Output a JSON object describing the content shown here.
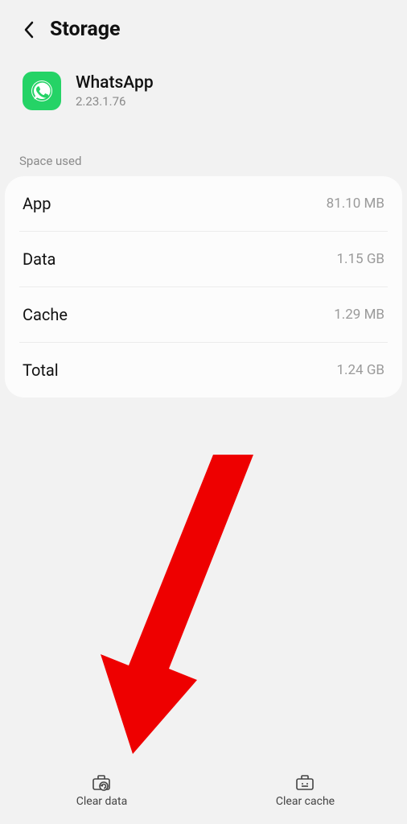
{
  "header": {
    "title": "Storage"
  },
  "app": {
    "name": "WhatsApp",
    "version": "2.23.1.76"
  },
  "section_label": "Space used",
  "rows": [
    {
      "label": "App",
      "value": "81.10 MB"
    },
    {
      "label": "Data",
      "value": "1.15 GB"
    },
    {
      "label": "Cache",
      "value": "1.29 MB"
    },
    {
      "label": "Total",
      "value": "1.24 GB"
    }
  ],
  "buttons": {
    "clear_data": "Clear data",
    "clear_cache": "Clear cache"
  }
}
